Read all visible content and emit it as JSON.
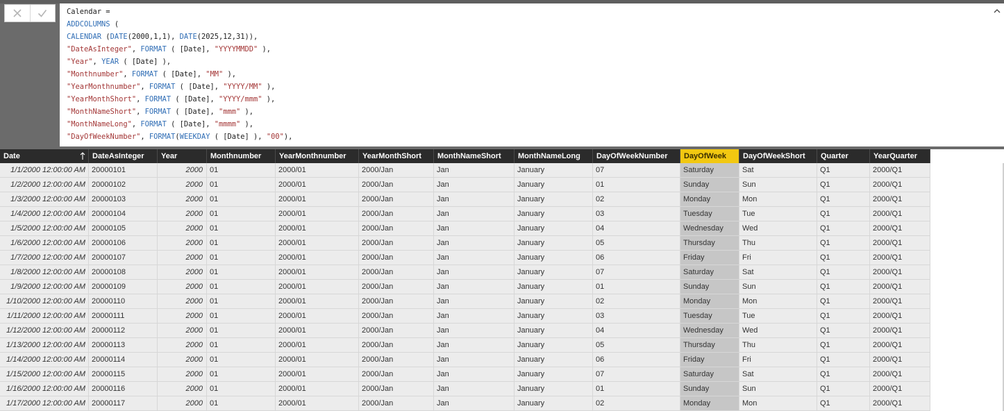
{
  "formula_bar": {
    "cancel_label": "✕",
    "commit_label": "✓",
    "lines": [
      [
        {
          "t": "Calendar =",
          "c": ""
        }
      ],
      [
        {
          "t": "ADDCOLUMNS",
          "c": "kw"
        },
        {
          "t": " (",
          "c": ""
        }
      ],
      [
        {
          "t": "CALENDAR",
          "c": "kw"
        },
        {
          "t": " (",
          "c": ""
        },
        {
          "t": "DATE",
          "c": "kw"
        },
        {
          "t": "(2000,1,1), ",
          "c": ""
        },
        {
          "t": "DATE",
          "c": "kw"
        },
        {
          "t": "(2025,12,31)),",
          "c": ""
        }
      ],
      [
        {
          "t": "\"DateAsInteger\"",
          "c": "str"
        },
        {
          "t": ", ",
          "c": ""
        },
        {
          "t": "FORMAT",
          "c": "kw"
        },
        {
          "t": " ( [Date], ",
          "c": ""
        },
        {
          "t": "\"YYYYMMDD\"",
          "c": "str"
        },
        {
          "t": " ),",
          "c": ""
        }
      ],
      [
        {
          "t": "\"Year\"",
          "c": "str"
        },
        {
          "t": ", ",
          "c": ""
        },
        {
          "t": "YEAR",
          "c": "kw"
        },
        {
          "t": " ( [Date] ),",
          "c": ""
        }
      ],
      [
        {
          "t": "\"Monthnumber\"",
          "c": "str"
        },
        {
          "t": ", ",
          "c": ""
        },
        {
          "t": "FORMAT",
          "c": "kw"
        },
        {
          "t": " ( [Date], ",
          "c": ""
        },
        {
          "t": "\"MM\"",
          "c": "str"
        },
        {
          "t": " ),",
          "c": ""
        }
      ],
      [
        {
          "t": "\"YearMonthnumber\"",
          "c": "str"
        },
        {
          "t": ", ",
          "c": ""
        },
        {
          "t": "FORMAT",
          "c": "kw"
        },
        {
          "t": " ( [Date], ",
          "c": ""
        },
        {
          "t": "\"YYYY/MM\"",
          "c": "str"
        },
        {
          "t": " ),",
          "c": ""
        }
      ],
      [
        {
          "t": "\"YearMonthShort\"",
          "c": "str"
        },
        {
          "t": ", ",
          "c": ""
        },
        {
          "t": "FORMAT",
          "c": "kw"
        },
        {
          "t": " ( [Date], ",
          "c": ""
        },
        {
          "t": "\"YYYY/mmm\"",
          "c": "str"
        },
        {
          "t": " ),",
          "c": ""
        }
      ],
      [
        {
          "t": "\"MonthNameShort\"",
          "c": "str"
        },
        {
          "t": ", ",
          "c": ""
        },
        {
          "t": "FORMAT",
          "c": "kw"
        },
        {
          "t": " ( [Date], ",
          "c": ""
        },
        {
          "t": "\"mmm\"",
          "c": "str"
        },
        {
          "t": " ),",
          "c": ""
        }
      ],
      [
        {
          "t": "\"MonthNameLong\"",
          "c": "str"
        },
        {
          "t": ", ",
          "c": ""
        },
        {
          "t": "FORMAT",
          "c": "kw"
        },
        {
          "t": " ( [Date], ",
          "c": ""
        },
        {
          "t": "\"mmmm\"",
          "c": "str"
        },
        {
          "t": " ),",
          "c": ""
        }
      ],
      [
        {
          "t": "\"DayOfWeekNumber\"",
          "c": "str"
        },
        {
          "t": ", ",
          "c": ""
        },
        {
          "t": "FORMAT",
          "c": "kw"
        },
        {
          "t": "(",
          "c": ""
        },
        {
          "t": "WEEKDAY",
          "c": "kw"
        },
        {
          "t": " ( [Date] ), ",
          "c": ""
        },
        {
          "t": "\"00\"",
          "c": "str"
        },
        {
          "t": "),",
          "c": ""
        }
      ]
    ]
  },
  "colors": {
    "selected_header": "#f2c811",
    "keyword": "#2f6db5",
    "string": "#a33636"
  },
  "table": {
    "columns": [
      "Date",
      "DateAsInteger",
      "Year",
      "Monthnumber",
      "YearMonthnumber",
      "YearMonthShort",
      "MonthNameShort",
      "MonthNameLong",
      "DayOfWeekNumber",
      "DayOfWeek",
      "DayOfWeekShort",
      "Quarter",
      "YearQuarter"
    ],
    "selected_column": "DayOfWeek",
    "sorted_column": "Date",
    "rows": [
      [
        "1/1/2000 12:00:00 AM",
        "20000101",
        "2000",
        "01",
        "2000/01",
        "2000/Jan",
        "Jan",
        "January",
        "07",
        "Saturday",
        "Sat",
        "Q1",
        "2000/Q1"
      ],
      [
        "1/2/2000 12:00:00 AM",
        "20000102",
        "2000",
        "01",
        "2000/01",
        "2000/Jan",
        "Jan",
        "January",
        "01",
        "Sunday",
        "Sun",
        "Q1",
        "2000/Q1"
      ],
      [
        "1/3/2000 12:00:00 AM",
        "20000103",
        "2000",
        "01",
        "2000/01",
        "2000/Jan",
        "Jan",
        "January",
        "02",
        "Monday",
        "Mon",
        "Q1",
        "2000/Q1"
      ],
      [
        "1/4/2000 12:00:00 AM",
        "20000104",
        "2000",
        "01",
        "2000/01",
        "2000/Jan",
        "Jan",
        "January",
        "03",
        "Tuesday",
        "Tue",
        "Q1",
        "2000/Q1"
      ],
      [
        "1/5/2000 12:00:00 AM",
        "20000105",
        "2000",
        "01",
        "2000/01",
        "2000/Jan",
        "Jan",
        "January",
        "04",
        "Wednesday",
        "Wed",
        "Q1",
        "2000/Q1"
      ],
      [
        "1/6/2000 12:00:00 AM",
        "20000106",
        "2000",
        "01",
        "2000/01",
        "2000/Jan",
        "Jan",
        "January",
        "05",
        "Thursday",
        "Thu",
        "Q1",
        "2000/Q1"
      ],
      [
        "1/7/2000 12:00:00 AM",
        "20000107",
        "2000",
        "01",
        "2000/01",
        "2000/Jan",
        "Jan",
        "January",
        "06",
        "Friday",
        "Fri",
        "Q1",
        "2000/Q1"
      ],
      [
        "1/8/2000 12:00:00 AM",
        "20000108",
        "2000",
        "01",
        "2000/01",
        "2000/Jan",
        "Jan",
        "January",
        "07",
        "Saturday",
        "Sat",
        "Q1",
        "2000/Q1"
      ],
      [
        "1/9/2000 12:00:00 AM",
        "20000109",
        "2000",
        "01",
        "2000/01",
        "2000/Jan",
        "Jan",
        "January",
        "01",
        "Sunday",
        "Sun",
        "Q1",
        "2000/Q1"
      ],
      [
        "1/10/2000 12:00:00 AM",
        "20000110",
        "2000",
        "01",
        "2000/01",
        "2000/Jan",
        "Jan",
        "January",
        "02",
        "Monday",
        "Mon",
        "Q1",
        "2000/Q1"
      ],
      [
        "1/11/2000 12:00:00 AM",
        "20000111",
        "2000",
        "01",
        "2000/01",
        "2000/Jan",
        "Jan",
        "January",
        "03",
        "Tuesday",
        "Tue",
        "Q1",
        "2000/Q1"
      ],
      [
        "1/12/2000 12:00:00 AM",
        "20000112",
        "2000",
        "01",
        "2000/01",
        "2000/Jan",
        "Jan",
        "January",
        "04",
        "Wednesday",
        "Wed",
        "Q1",
        "2000/Q1"
      ],
      [
        "1/13/2000 12:00:00 AM",
        "20000113",
        "2000",
        "01",
        "2000/01",
        "2000/Jan",
        "Jan",
        "January",
        "05",
        "Thursday",
        "Thu",
        "Q1",
        "2000/Q1"
      ],
      [
        "1/14/2000 12:00:00 AM",
        "20000114",
        "2000",
        "01",
        "2000/01",
        "2000/Jan",
        "Jan",
        "January",
        "06",
        "Friday",
        "Fri",
        "Q1",
        "2000/Q1"
      ],
      [
        "1/15/2000 12:00:00 AM",
        "20000115",
        "2000",
        "01",
        "2000/01",
        "2000/Jan",
        "Jan",
        "January",
        "07",
        "Saturday",
        "Sat",
        "Q1",
        "2000/Q1"
      ],
      [
        "1/16/2000 12:00:00 AM",
        "20000116",
        "2000",
        "01",
        "2000/01",
        "2000/Jan",
        "Jan",
        "January",
        "01",
        "Sunday",
        "Sun",
        "Q1",
        "2000/Q1"
      ],
      [
        "1/17/2000 12:00:00 AM",
        "20000117",
        "2000",
        "01",
        "2000/01",
        "2000/Jan",
        "Jan",
        "January",
        "02",
        "Monday",
        "Mon",
        "Q1",
        "2000/Q1"
      ]
    ]
  }
}
